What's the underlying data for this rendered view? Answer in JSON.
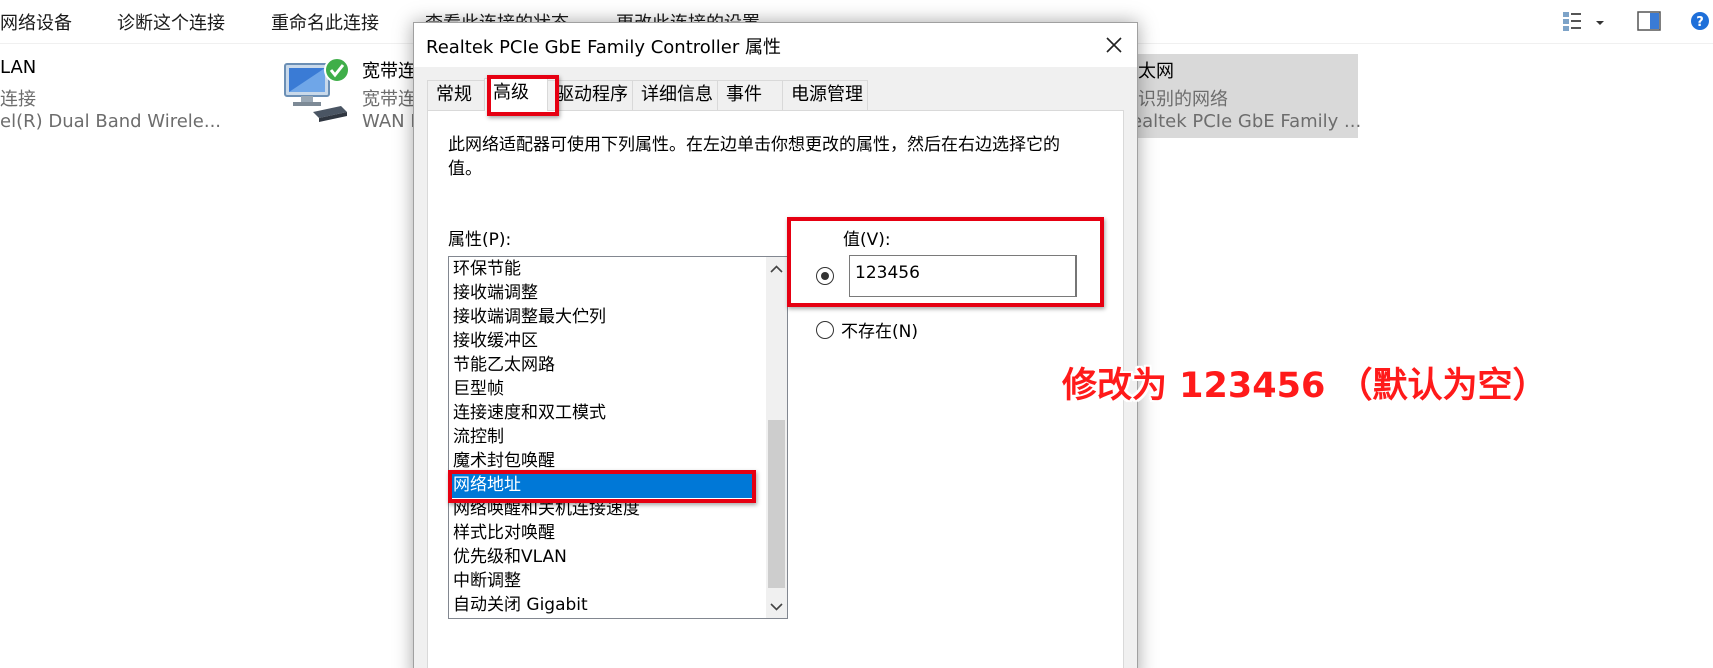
{
  "toolbar": {
    "commands": [
      "网络设备",
      "诊断这个连接",
      "重命名此连接",
      "查看此连接的状态",
      "更改此连接的设置"
    ]
  },
  "connections": [
    {
      "title": "LAN",
      "status": "连接",
      "device": "el(R) Dual Band Wirele..."
    },
    {
      "title": "宽带连",
      "status": "宽带连",
      "device": "WAN M"
    },
    {
      "title": "太网",
      "status": "识别的网络",
      "device": "ealtek PCIe GbE Family ..."
    }
  ],
  "dialog": {
    "title": "Realtek PCIe GbE Family Controller 属性",
    "tabs": [
      "常规",
      "高级",
      "驱动程序",
      "详细信息",
      "事件",
      "电源管理"
    ],
    "active_tab": "高级",
    "description": "此网络适配器可使用下列属性。在左边单击你想更改的属性，然后在右边选择它的值。",
    "property_label": "属性(P):",
    "properties": [
      "环保节能",
      "接收端调整",
      "接收端调整最大伫列",
      "接收缓冲区",
      "节能乙太网路",
      "巨型帧",
      "连接速度和双工模式",
      "流控制",
      "魔术封包唤醒",
      "网络地址",
      "网络唤醒和关机连接速度",
      "样式比对唤醒",
      "优先级和VLAN",
      "中断调整",
      "自动关闭 Gigabit"
    ],
    "selected_property": "网络地址",
    "value_label": "值(V):",
    "value": "123456",
    "not_present_label": "不存在(N)",
    "value_option_selected": "value"
  },
  "annotation": {
    "text": "修改为 123456 （默认为空）",
    "color": "#ff1a1a"
  },
  "colors": {
    "highlight_box": "#e60012",
    "selection": "#0078d7"
  }
}
